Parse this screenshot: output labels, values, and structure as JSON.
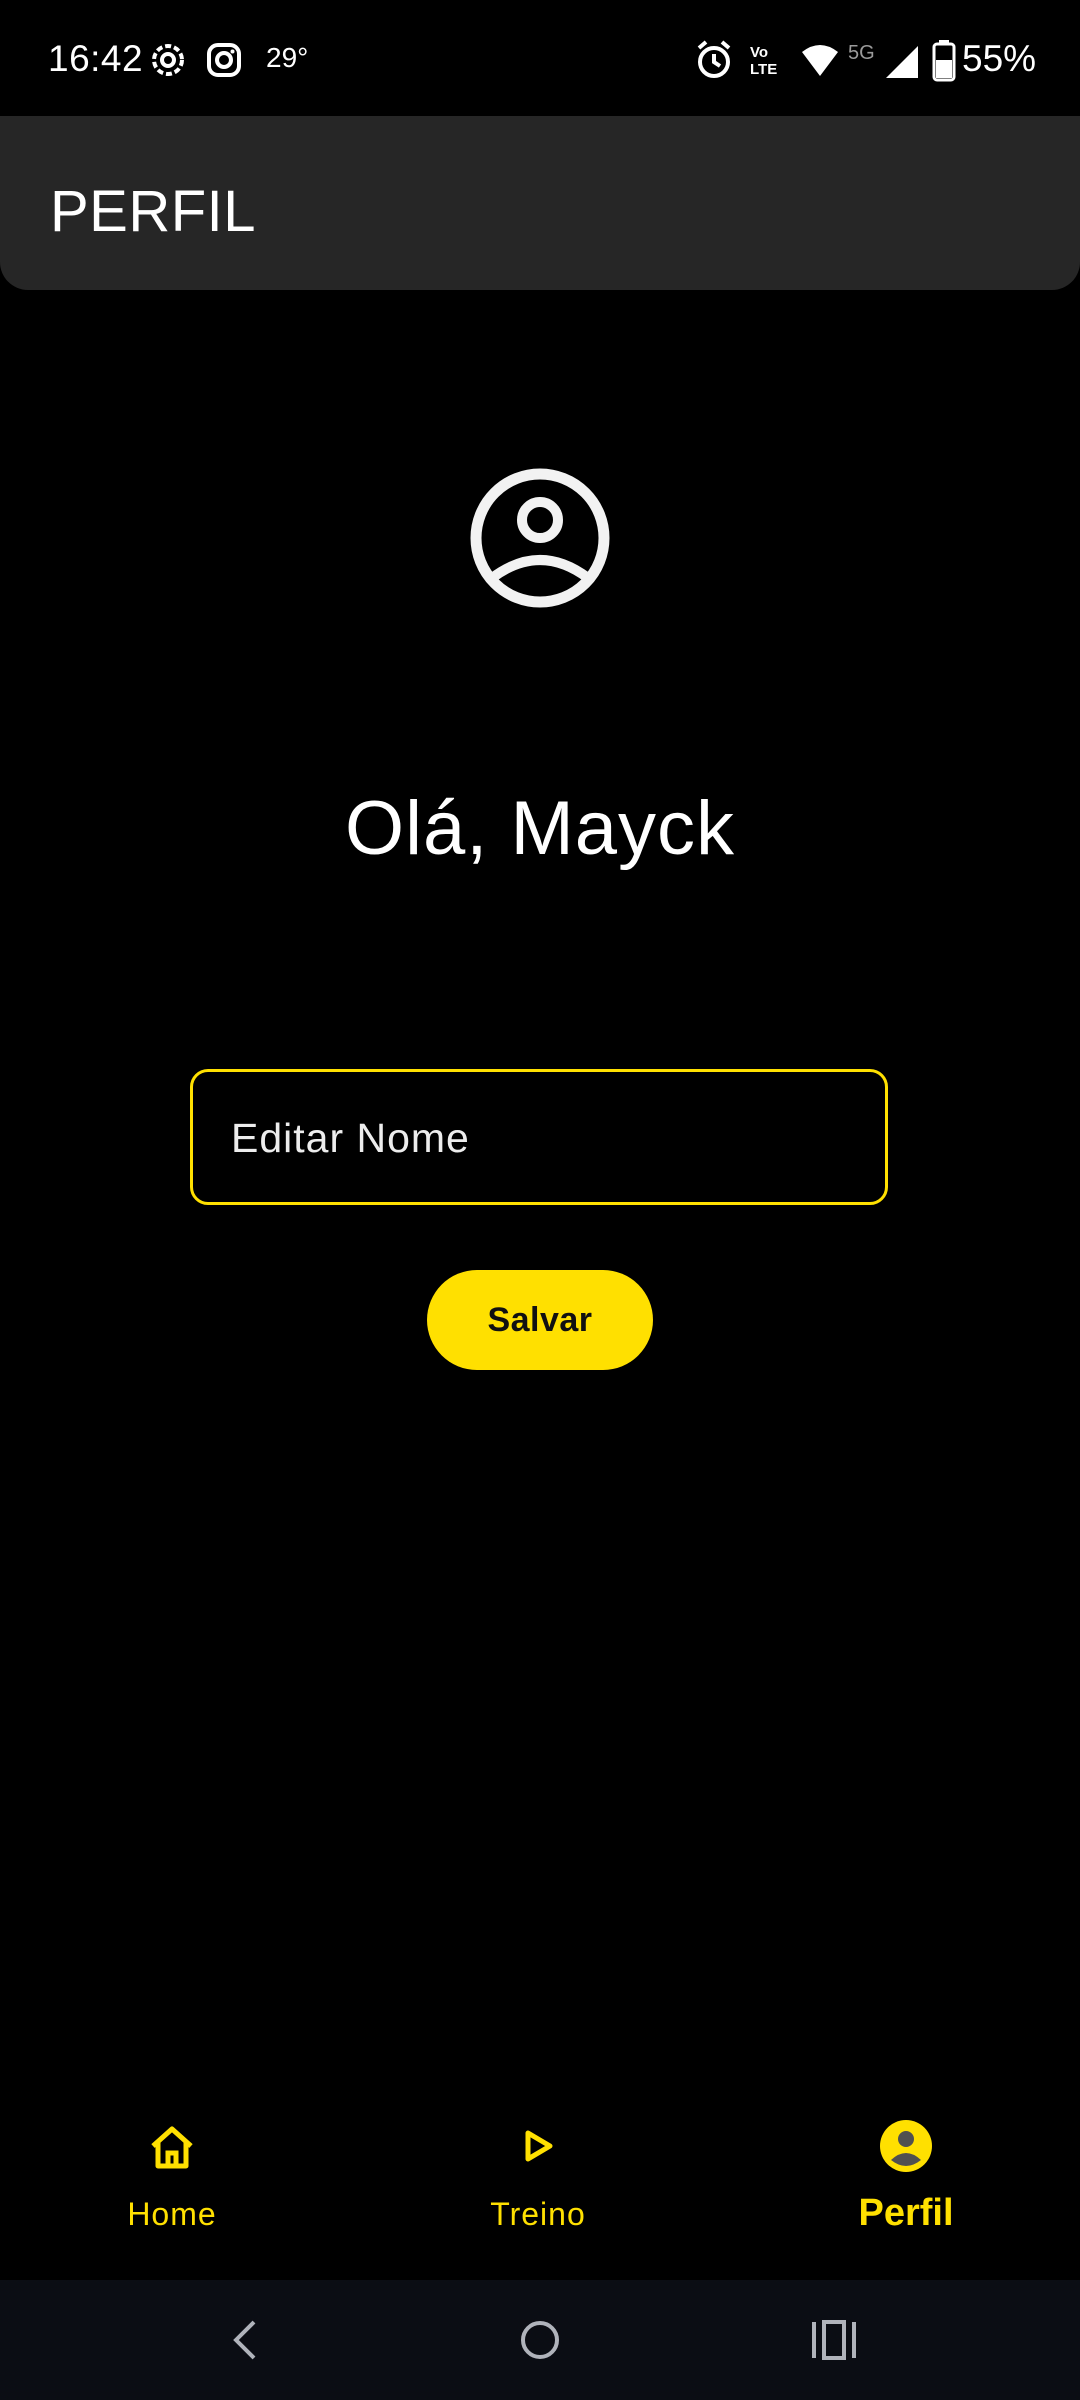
{
  "status_bar": {
    "time": "16:42",
    "temperature": "29°",
    "battery": "55%",
    "network_label": "5G",
    "volte_label": "Vo LTE",
    "icons": [
      "nfc-icon",
      "instagram-icon",
      "alarm-icon",
      "volte-icon",
      "wifi-icon",
      "signal-icon",
      "battery-icon"
    ]
  },
  "app_bar": {
    "title": "PERFIL"
  },
  "profile": {
    "greeting": "Olá, Mayck",
    "name_input_placeholder": "Editar Nome",
    "save_label": "Salvar"
  },
  "bottom_nav": {
    "items": [
      {
        "label": "Home",
        "icon": "home-icon"
      },
      {
        "label": "Treino",
        "icon": "play-icon"
      },
      {
        "label": "Perfil",
        "icon": "profile-icon",
        "active": true
      }
    ]
  },
  "colors": {
    "accent": "#ffe000",
    "background": "#000000",
    "app_bar": "#262626",
    "active_pill": "#505050"
  }
}
